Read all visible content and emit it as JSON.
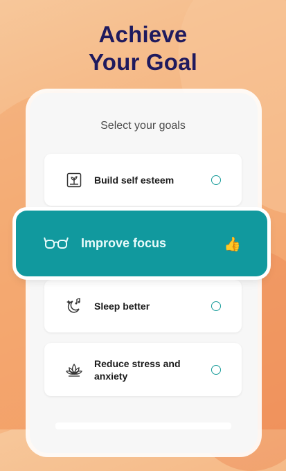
{
  "headline": {
    "line1": "Achieve",
    "line2": "Your Goal"
  },
  "subtitle": "Select your goals",
  "goals": [
    {
      "label": "Build self esteem",
      "icon": "plant-icon",
      "selected": false
    },
    {
      "label": "Improve focus",
      "icon": "glasses-icon",
      "selected": true,
      "selected_badge": "👍"
    },
    {
      "label": "Sleep better",
      "icon": "moon-music-icon",
      "selected": false
    },
    {
      "label": "Reduce stress and anxiety",
      "icon": "lotus-icon",
      "selected": false
    }
  ],
  "colors": {
    "headline": "#1f1a5e",
    "accent": "#11999e",
    "background": "#f4b07a",
    "card": "#ffffff"
  }
}
